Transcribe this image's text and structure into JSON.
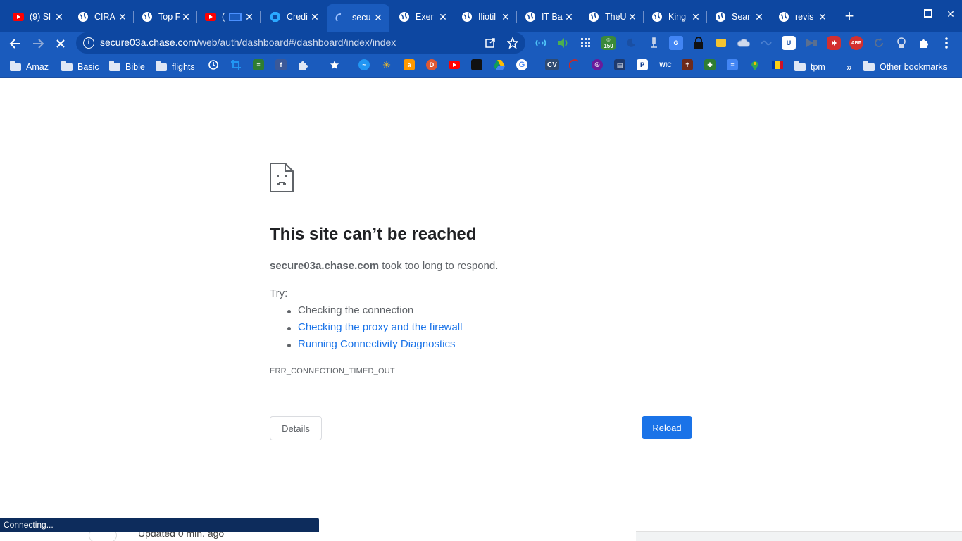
{
  "browser": {
    "tabs": [
      {
        "title": "(9) Sl",
        "icon": "youtube-icon"
      },
      {
        "title": "CIRA",
        "icon": "globe-icon"
      },
      {
        "title": "Top F",
        "icon": "globe-icon"
      },
      {
        "title": "(",
        "icon": "youtube-icon"
      },
      {
        "title": "Credi",
        "icon": "chase-icon"
      },
      {
        "title": "secu",
        "icon": "loading-spinner-icon",
        "active": true
      },
      {
        "title": "Exer",
        "icon": "globe-icon"
      },
      {
        "title": "Iliotil",
        "icon": "globe-icon"
      },
      {
        "title": "IT Ba",
        "icon": "globe-icon"
      },
      {
        "title": "TheU",
        "icon": "globe-icon"
      },
      {
        "title": "King",
        "icon": "globe-icon"
      },
      {
        "title": "Sear",
        "icon": "globe-icon"
      },
      {
        "title": "revis",
        "icon": "globe-icon"
      }
    ],
    "url_host": "secure03a.chase.com",
    "url_path": "/web/auth/dashboard#/dashboard/index/index",
    "ext_badge": "150",
    "ext_abp": "ABP"
  },
  "bookmarks": {
    "folders": [
      "Amaz",
      "Basic",
      "Bible",
      "flights"
    ],
    "tpm": "tpm",
    "other": "Other bookmarks",
    "cv": "CV",
    "wic": "WIC"
  },
  "error": {
    "title": "This site can’t be reached",
    "host": "secure03a.chase.com",
    "message": " took too long to respond.",
    "try_label": "Try:",
    "suggestion_1": "Checking the connection",
    "suggestion_2": "Checking the proxy and the firewall",
    "suggestion_3": "Running Connectivity Diagnostics",
    "code": "ERR_CONNECTION_TIMED_OUT",
    "details_label": "Details",
    "reload_label": "Reload"
  },
  "status_text": "Connecting...",
  "background_text": "Updated 0 min. ago"
}
